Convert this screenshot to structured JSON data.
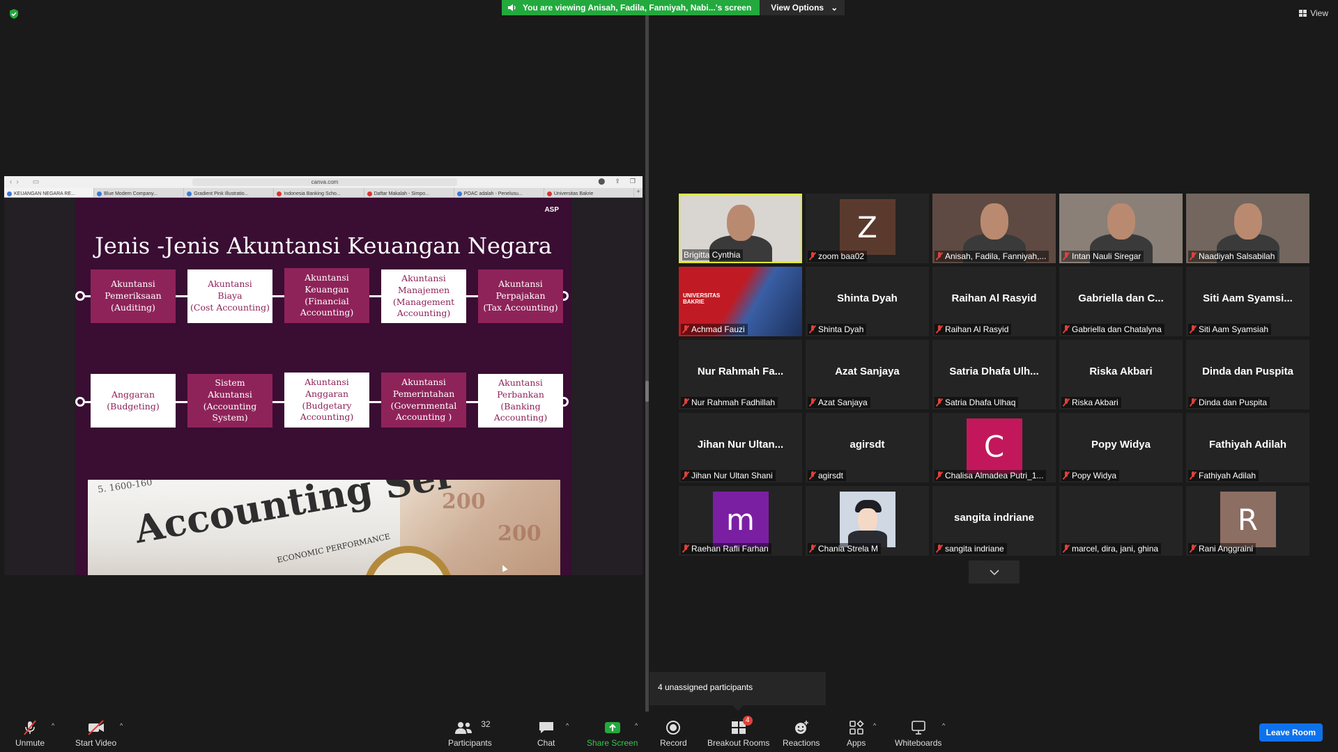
{
  "banner": {
    "message": "You are viewing Anisah, Fadila, Fanniyah, Nabi...'s screen",
    "options": "View Options"
  },
  "view_button": "View",
  "browser": {
    "url": "canva.com",
    "tabs": [
      "KEUANGAN NEGARA RE...",
      "Blue Modern Company...",
      "Gradient Pink Illustratio...",
      "Indonesia Banking Scho...",
      "Daftar Makalah - Simpo...",
      "POAC adalah - Penelusu...",
      "Universitas Bakrie"
    ]
  },
  "slide": {
    "badge": "ASP",
    "title": "Jenis -Jenis Akuntansi Keuangan Negara",
    "row1": [
      "Akuntansi\nPemeriksaan\n(Auditing)",
      "Akuntansi\nBiaya\n(Cost Accounting)",
      "Akuntansi\nKeuangan\n(Financial\nAccounting)",
      "Akuntansi\nManajemen\n(Management\nAccounting)",
      "Akuntansi\nPerpajakan\n(Tax Accounting)"
    ],
    "row2": [
      "Anggaran\n(Budgeting)",
      "Sistem\nAkuntansi\n(Accounting System)",
      "Akuntansi\nAnggaran\n(Budgetary\nAccounting)",
      "Akuntansi\nPemerintahan\n(Governmental\nAccounting )",
      "Akuntansi\nPerbankan\n(Banking\nAccounting)"
    ],
    "photo": {
      "headline": "Accounting Ser",
      "sub": "ECONOMIC PERFORMANCE",
      "year": "5. 1600-160",
      "money": "200"
    }
  },
  "participants": [
    {
      "label": "Brigitta Cynthia",
      "type": "video",
      "active": true,
      "muted": false
    },
    {
      "label": "zoom baa02",
      "type": "avatar",
      "letter": "Z",
      "color": "#5b3a2e",
      "muted": true
    },
    {
      "label": "Anisah, Fadila, Fanniyah,...",
      "type": "video",
      "muted": true
    },
    {
      "label": "Intan Nauli Siregar",
      "type": "video",
      "muted": true
    },
    {
      "label": "Naadiyah Salsabilah",
      "type": "video",
      "muted": true
    },
    {
      "label": "Achmad Fauzi",
      "type": "image",
      "muted": true,
      "text": "UNIVERSITAS BAKRIE"
    },
    {
      "label": "Shinta Dyah",
      "type": "name",
      "name": "Shinta Dyah",
      "muted": true
    },
    {
      "label": "Raihan Al Rasyid",
      "type": "name",
      "name": "Raihan Al Rasyid",
      "muted": true
    },
    {
      "label": "Gabriella dan Chatalyna",
      "type": "name",
      "name": "Gabriella dan C...",
      "muted": true
    },
    {
      "label": "Siti Aam Syamsiah",
      "type": "name",
      "name": "Siti Aam Syamsi...",
      "muted": true
    },
    {
      "label": "Nur Rahmah Fadhillah",
      "type": "name",
      "name": "Nur Rahmah Fa...",
      "muted": true
    },
    {
      "label": "Azat Sanjaya",
      "type": "name",
      "name": "Azat Sanjaya",
      "muted": true
    },
    {
      "label": "Satria Dhafa Ulhaq",
      "type": "name",
      "name": "Satria Dhafa Ulh...",
      "muted": true
    },
    {
      "label": "Riska Akbari",
      "type": "name",
      "name": "Riska Akbari",
      "muted": true
    },
    {
      "label": "Dinda dan Puspita",
      "type": "name",
      "name": "Dinda dan Puspita",
      "muted": true
    },
    {
      "label": "Jihan Nur Ultan Shani",
      "type": "name",
      "name": "Jihan Nur Ultan...",
      "muted": true
    },
    {
      "label": "agirsdt",
      "type": "name",
      "name": "agirsdt",
      "muted": true
    },
    {
      "label": "Chalisa Almadea Putri_1...",
      "type": "avatar",
      "letter": "C",
      "color": "#c2185b",
      "muted": true
    },
    {
      "label": "Popy Widya",
      "type": "name",
      "name": "Popy Widya",
      "muted": true
    },
    {
      "label": "Fathiyah Adilah",
      "type": "name",
      "name": "Fathiyah Adilah",
      "muted": true
    },
    {
      "label": "Raehan Rafli Farhan",
      "type": "avatar",
      "letter": "m",
      "color": "#7b1fa2",
      "muted": true
    },
    {
      "label": "Chania Strela M",
      "type": "illustration",
      "muted": true
    },
    {
      "label": "sangita indriane",
      "type": "name",
      "name": "sangita indriane",
      "muted": true
    },
    {
      "label": "marcel, dira, jani, ghina",
      "type": "blank",
      "muted": true
    },
    {
      "label": "Rani Anggraini",
      "type": "avatar",
      "letter": "R",
      "color": "#8d6e63",
      "muted": true
    }
  ],
  "unassigned": "4 unassigned participants",
  "toolbar": {
    "unmute": "Unmute",
    "start_video": "Start Video",
    "participants": "Participants",
    "participants_count": "32",
    "chat": "Chat",
    "share_screen": "Share Screen",
    "record": "Record",
    "breakout_rooms": "Breakout Rooms",
    "breakout_badge": "4",
    "reactions": "Reactions",
    "apps": "Apps",
    "whiteboards": "Whiteboards",
    "leave": "Leave Room"
  },
  "colors": {
    "share_green": "#23a93e",
    "slide_bg": "#3a0d33",
    "box_dark": "#8e2359",
    "active_border": "#dfe92f",
    "leave_blue": "#0e72ed"
  }
}
